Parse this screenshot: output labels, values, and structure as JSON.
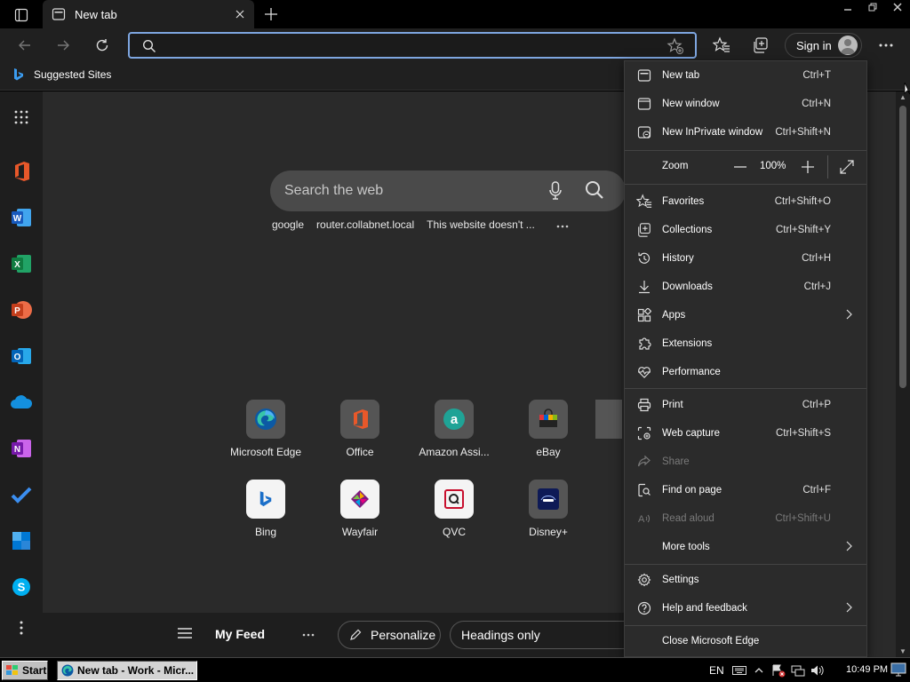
{
  "window": {
    "tab_title": "New tab"
  },
  "toolbar": {
    "address_value": "",
    "signin_label": "Sign in"
  },
  "favorites_bar": {
    "items": [
      {
        "label": "Suggested Sites"
      }
    ]
  },
  "newtab": {
    "search_placeholder": "Search the web",
    "quick_links": [
      "google",
      "router.collabnet.local",
      "This website doesn't ..."
    ],
    "tiles": [
      {
        "label": "Microsoft Edge",
        "icon": "edge-icon"
      },
      {
        "label": "Office",
        "icon": "office-icon"
      },
      {
        "label": "Amazon Assi...",
        "icon": "amazon-icon"
      },
      {
        "label": "eBay",
        "icon": "ebay-icon"
      },
      {
        "label": "Bing",
        "icon": "bing-icon"
      },
      {
        "label": "Wayfair",
        "icon": "wayfair-icon"
      },
      {
        "label": "QVC",
        "icon": "qvc-icon"
      },
      {
        "label": "Disney+",
        "icon": "disney-icon"
      }
    ],
    "feed": {
      "title": "My Feed",
      "personalize": "Personalize",
      "headings": "Headings only"
    }
  },
  "menu": {
    "new_tab": {
      "label": "New tab",
      "shortcut": "Ctrl+T"
    },
    "new_window": {
      "label": "New window",
      "shortcut": "Ctrl+N"
    },
    "new_inprivate": {
      "label": "New InPrivate window",
      "shortcut": "Ctrl+Shift+N"
    },
    "zoom": {
      "label": "Zoom",
      "value": "100%"
    },
    "favorites": {
      "label": "Favorites",
      "shortcut": "Ctrl+Shift+O"
    },
    "collections": {
      "label": "Collections",
      "shortcut": "Ctrl+Shift+Y"
    },
    "history": {
      "label": "History",
      "shortcut": "Ctrl+H"
    },
    "downloads": {
      "label": "Downloads",
      "shortcut": "Ctrl+J"
    },
    "apps": {
      "label": "Apps"
    },
    "extensions": {
      "label": "Extensions"
    },
    "performance": {
      "label": "Performance"
    },
    "print": {
      "label": "Print",
      "shortcut": "Ctrl+P"
    },
    "web_capture": {
      "label": "Web capture",
      "shortcut": "Ctrl+Shift+S"
    },
    "share": {
      "label": "Share"
    },
    "find_on_page": {
      "label": "Find on page",
      "shortcut": "Ctrl+F"
    },
    "read_aloud": {
      "label": "Read aloud",
      "shortcut": "Ctrl+Shift+U"
    },
    "more_tools": {
      "label": "More tools"
    },
    "settings": {
      "label": "Settings"
    },
    "help": {
      "label": "Help and feedback"
    },
    "close_edge": {
      "label": "Close Microsoft Edge"
    }
  },
  "taskbar": {
    "start_label": "Start",
    "task_label": "New tab - Work - Micr...",
    "language": "EN",
    "clock": "10:49 PM"
  },
  "colors": {
    "accent_border": "#7ea6e0",
    "menu_bg": "#2b2b2b",
    "content_bg": "#2a2a2a"
  }
}
